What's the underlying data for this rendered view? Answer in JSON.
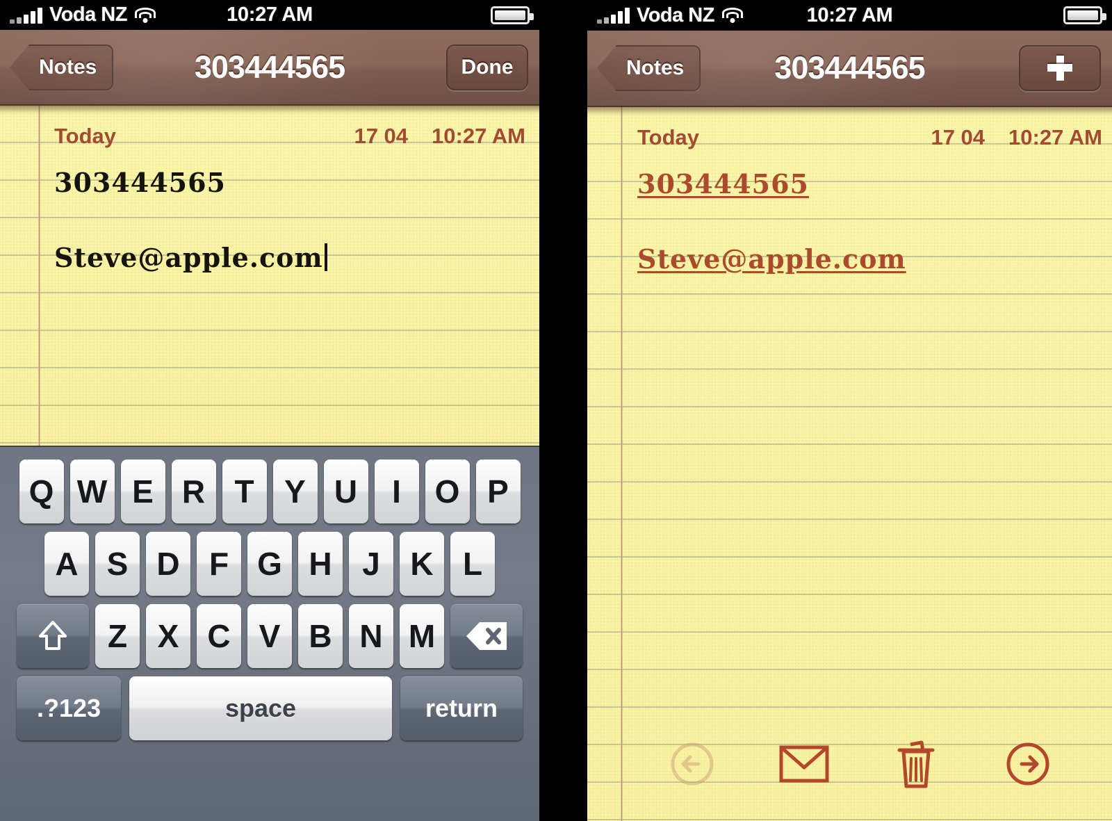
{
  "status_bar": {
    "carrier": "Voda NZ",
    "time": "10:27 AM",
    "icons": {
      "signal": "signal-bars-icon",
      "wifi": "wifi-icon",
      "battery": "battery-icon"
    }
  },
  "left_phone": {
    "navbar": {
      "back_label": "Notes",
      "title": "303444565",
      "action_label": "Done"
    },
    "note": {
      "day_label": "Today",
      "date": "17 04",
      "time": "10:27 AM",
      "lines": [
        {
          "text": "303444565",
          "style": "plain"
        },
        {
          "text": "Steve@apple.com",
          "style": "plain",
          "caret": true
        }
      ]
    },
    "keyboard": {
      "row1": [
        "Q",
        "W",
        "E",
        "R",
        "T",
        "Y",
        "U",
        "I",
        "O",
        "P"
      ],
      "row2": [
        "A",
        "S",
        "D",
        "F",
        "G",
        "H",
        "J",
        "K",
        "L"
      ],
      "row3": [
        "Z",
        "X",
        "C",
        "V",
        "B",
        "N",
        "M"
      ],
      "shift_icon": "shift-arrow-icon",
      "backspace_icon": "backspace-delete-icon",
      "numbers_label": ".?123",
      "space_label": "space",
      "return_label": "return"
    }
  },
  "right_phone": {
    "navbar": {
      "back_label": "Notes",
      "title": "303444565",
      "action_label": "+"
    },
    "note": {
      "day_label": "Today",
      "date": "17 04",
      "time": "10:27 AM",
      "lines": [
        {
          "text": "303444565",
          "style": "link"
        },
        {
          "text": "Steve@apple.com",
          "style": "link"
        }
      ]
    },
    "toolbar": {
      "items": [
        {
          "name": "previous-note-button",
          "icon": "arrow-left-circle-icon",
          "disabled": true
        },
        {
          "name": "mail-note-button",
          "icon": "envelope-icon",
          "disabled": false
        },
        {
          "name": "delete-note-button",
          "icon": "trash-icon",
          "disabled": false
        },
        {
          "name": "next-note-button",
          "icon": "arrow-right-circle-icon",
          "disabled": false
        }
      ]
    }
  },
  "colors": {
    "paper_yellow": "#f8f09b",
    "navbar_brown": "#7d5c50",
    "link_red": "#ab4a2c",
    "heading_red": "#a34a33",
    "keyboard_gray": "#747b87",
    "rule_line": "#969e82"
  }
}
